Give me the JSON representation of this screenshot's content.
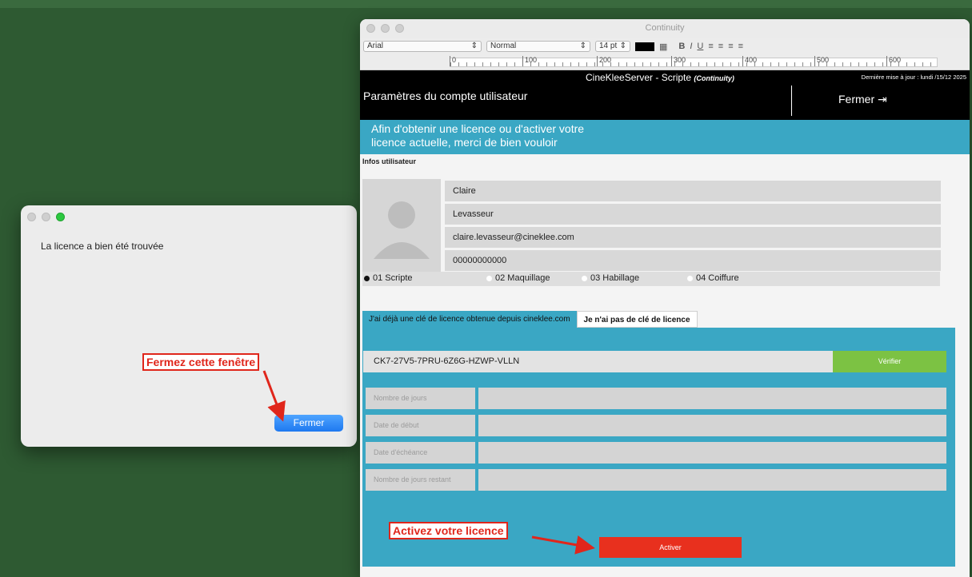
{
  "desktop": {},
  "dialog": {
    "message": "La licence a bien été trouvée",
    "close_button": "Fermer"
  },
  "annotations": {
    "close_hint": "Fermez cette fenêtre",
    "activate_hint": "Activez votre licence",
    "color": "#e0261b"
  },
  "window": {
    "title": "Continuity",
    "toolbar": {
      "font": "Arial",
      "style": "Normal",
      "size": "14 pt",
      "bold": "B",
      "italic": "I",
      "underline": "U"
    },
    "ruler": [
      "0",
      "100",
      "200",
      "300",
      "400",
      "500",
      "600"
    ],
    "header": {
      "server": "CineKleeServer - Scripte",
      "server_sub": "(Continuity)",
      "updated": "Dernière mise à jour : lundi /15/12 2025",
      "page_title": "Paramètres du compte utilisateur",
      "close": "Fermer"
    },
    "banner": {
      "line1": "Afin d'obtenir une licence ou d'activer votre",
      "line2": "licence actuelle, merci de bien vouloir"
    },
    "user": {
      "section_title": "Infos utilisateur",
      "first_name": "Claire",
      "last_name": "Levasseur",
      "email": "claire.levasseur@cineklee.com",
      "phone": "00000000000"
    },
    "roles": [
      {
        "label": "01  Scripte",
        "selected": true
      },
      {
        "label": "02  Maquillage",
        "selected": false
      },
      {
        "label": "03  Habillage",
        "selected": false
      },
      {
        "label": "04  Coiffure",
        "selected": false
      }
    ],
    "tabs": [
      {
        "label": "J'ai déjà une clé de licence obtenue depuis cineklee.com",
        "active": true
      },
      {
        "label": "Je n'ai pas de clé de licence",
        "active": false
      }
    ],
    "license": {
      "key": "CK7-27V5-7PRU-6Z6G-HZWP-VLLN",
      "verify_button": "Vérifier",
      "fields": [
        {
          "label": "Nombre de jours",
          "value": ""
        },
        {
          "label": "Date de début",
          "value": ""
        },
        {
          "label": "Date d'échéance",
          "value": ""
        },
        {
          "label": "Nombre de jours restant",
          "value": ""
        }
      ],
      "activate_button": "Activer"
    },
    "colors": {
      "accent": "#3aa7c4",
      "verify": "#7cc243",
      "activate": "#e8301e",
      "header": "#000000"
    }
  }
}
